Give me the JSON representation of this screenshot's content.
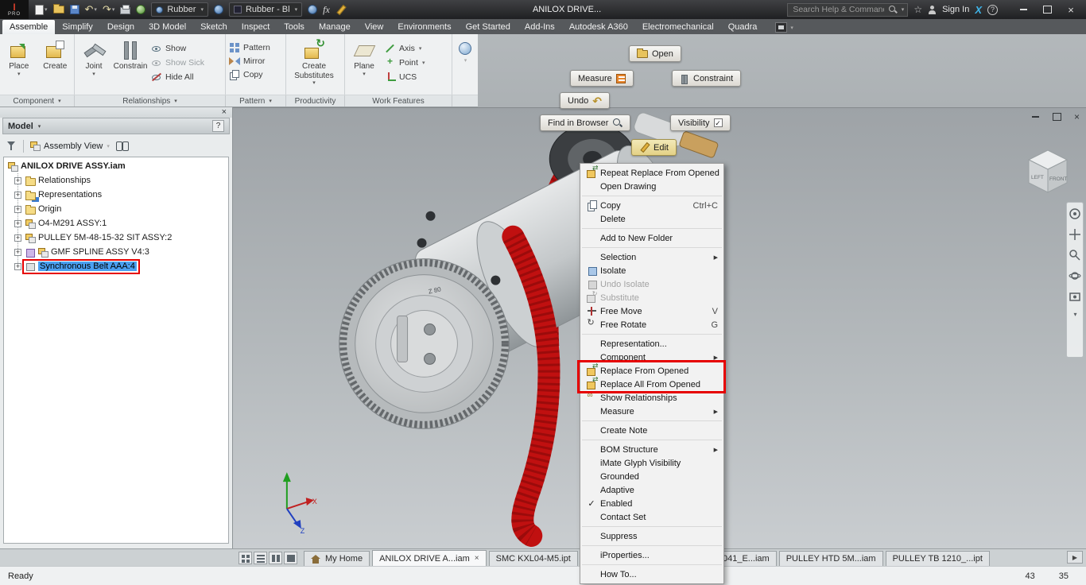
{
  "colors": {
    "annotation": "#e60000",
    "selection": "#4aa0f2"
  },
  "titlebar": {
    "logo_main": "I",
    "logo_sub": "PRO",
    "material_value": "Rubber",
    "appearance_value": "Rubber - Bl",
    "fx_label": "fx",
    "doc_title": "ANILOX DRIVE...",
    "search_placeholder": "Search Help & Commands...",
    "sign_in_label": "Sign In",
    "help_label": "?"
  },
  "ribbon": {
    "tabs": [
      {
        "label": "Assemble",
        "active": true
      },
      {
        "label": "Simplify"
      },
      {
        "label": "Design"
      },
      {
        "label": "3D Model"
      },
      {
        "label": "Sketch"
      },
      {
        "label": "Inspect"
      },
      {
        "label": "Tools"
      },
      {
        "label": "Manage"
      },
      {
        "label": "View"
      },
      {
        "label": "Environments"
      },
      {
        "label": "Get Started"
      },
      {
        "label": "Add-Ins"
      },
      {
        "label": "Autodesk A360"
      },
      {
        "label": "Electromechanical"
      },
      {
        "label": "Quadra"
      }
    ],
    "buttons": {
      "place": "Place",
      "create": "Create",
      "joint": "Joint",
      "constrain": "Constrain",
      "show": "Show",
      "show_sick": "Show Sick",
      "hide_all": "Hide All",
      "pattern": "Pattern",
      "mirror": "Mirror",
      "copy": "Copy",
      "create_substitutes": "Create Substitutes",
      "plane": "Plane",
      "axis": "Axis",
      "point": "Point",
      "ucs": "UCS"
    },
    "panels": [
      {
        "label": "Component",
        "caret": true
      },
      {
        "label": "Relationships",
        "caret": true
      },
      {
        "label": "Pattern",
        "caret": true
      },
      {
        "label": "Productivity"
      },
      {
        "label": "Work Features"
      }
    ]
  },
  "overlay_buttons": {
    "open": "Open",
    "measure": "Measure",
    "constraint": "Constraint",
    "undo": "Undo",
    "find_in_browser": "Find in Browser",
    "visibility": "Visibility",
    "edit": "Edit"
  },
  "browser": {
    "title": "Model",
    "help_label": "?",
    "view_mode": "Assembly View",
    "tree": [
      {
        "label": "ANILOX DRIVE ASSY.iam",
        "icon": "assembly",
        "level": 0,
        "root": true
      },
      {
        "label": "Relationships",
        "icon": "folder",
        "level": 1,
        "exp": "+"
      },
      {
        "label": "Representations",
        "icon": "folder-reps",
        "level": 1,
        "exp": "+"
      },
      {
        "label": "Origin",
        "icon": "folder",
        "level": 1,
        "exp": "+"
      },
      {
        "label": "O4-M291 ASSY:1",
        "icon": "assembly",
        "level": 1,
        "exp": "+"
      },
      {
        "label": "PULLEY 5M-48-15-32 SIT ASSY:2",
        "icon": "assembly",
        "level": 1,
        "exp": "+"
      },
      {
        "label": "GMF SPLINE ASSY V4:3",
        "icon": "assembly",
        "level": 1,
        "exp": "+",
        "extra_icon": true
      },
      {
        "label": "Synchronous Belt AAA:4",
        "icon": "part",
        "level": 1,
        "exp": "+",
        "selected": true
      }
    ]
  },
  "viewport": {
    "gear_label": "Z 80",
    "viewcube_left": "LEFT",
    "viewcube_front": "FRONT",
    "axis_x": "X",
    "axis_z": "Z"
  },
  "context_menu": {
    "items": [
      {
        "label": "Repeat Replace From Opened",
        "icon": "replace"
      },
      {
        "label": "Open Drawing"
      },
      {
        "sep": true
      },
      {
        "label": "Copy",
        "icon": "copy",
        "shortcut": "Ctrl+C"
      },
      {
        "label": "Delete"
      },
      {
        "sep": true
      },
      {
        "label": "Add to New Folder"
      },
      {
        "sep": true
      },
      {
        "label": "Selection",
        "submenu": true
      },
      {
        "label": "Isolate",
        "icon": "isolate"
      },
      {
        "label": "Undo Isolate",
        "icon": "undo-isolate",
        "disabled": true
      },
      {
        "label": "Substitute",
        "icon": "substitute",
        "disabled": true
      },
      {
        "label": "Free Move",
        "icon": "free-move",
        "shortcut": "V"
      },
      {
        "label": "Free Rotate",
        "icon": "free-rotate",
        "shortcut": "G"
      },
      {
        "sep": true
      },
      {
        "label": "Representation..."
      },
      {
        "label": "Component",
        "submenu": true
      },
      {
        "label": "Replace From Opened",
        "icon": "replace",
        "highlighted": true
      },
      {
        "label": "Replace All From Opened",
        "icon": "replace-all",
        "highlighted": true
      },
      {
        "label": "Show Relationships",
        "icon": "show-rel"
      },
      {
        "label": "Measure",
        "submenu": true
      },
      {
        "sep": true
      },
      {
        "label": "Create Note"
      },
      {
        "sep": true
      },
      {
        "label": "BOM Structure",
        "submenu": true
      },
      {
        "label": "iMate Glyph Visibility"
      },
      {
        "label": "Grounded"
      },
      {
        "label": "Adaptive"
      },
      {
        "label": "Enabled",
        "checked": true
      },
      {
        "label": "Contact Set"
      },
      {
        "sep": true
      },
      {
        "label": "Suppress"
      },
      {
        "sep": true
      },
      {
        "label": "iProperties..."
      },
      {
        "sep": true
      },
      {
        "label": "How To..."
      }
    ]
  },
  "doc_tabs": {
    "tabs": [
      {
        "label": "My Home",
        "home": true
      },
      {
        "label": "ANILOX DRIVE A...iam",
        "active": true,
        "close": true
      },
      {
        "label": "SMC KXL04-M5.ipt"
      },
      {
        "label": "15041_E...iam",
        "gap_before": true
      },
      {
        "label": "PULLEY HTD 5M...iam"
      },
      {
        "label": "PULLEY TB 1210_...ipt"
      }
    ]
  },
  "status_bar": {
    "message": "Ready",
    "counter_a": "43",
    "counter_b": "35"
  },
  "icons": {
    "caret": "▾",
    "submenu": "▶",
    "close": "×",
    "check": "✓",
    "star": "☆",
    "undo_arrow": "↶",
    "redo_arrow": "↷",
    "scroll_right": "▶"
  }
}
